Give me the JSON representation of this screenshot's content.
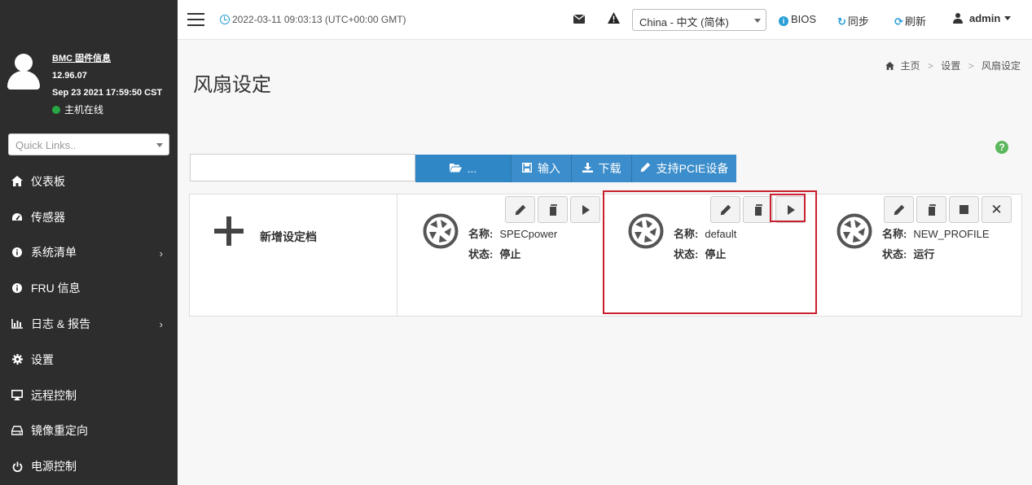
{
  "sidebar": {
    "firmware_link": "BMC 固件信息",
    "version": "12.96.07",
    "build_date": "Sep 23 2021 17:59:50 CST",
    "host_status": "主机在线",
    "quick_links_placeholder": "Quick Links..",
    "items": [
      {
        "label": "仪表板",
        "icon": "home-icon",
        "expandable": false
      },
      {
        "label": "传感器",
        "icon": "gauge-icon",
        "expandable": false
      },
      {
        "label": "系统清单",
        "icon": "info-icon",
        "expandable": true
      },
      {
        "label": "FRU 信息",
        "icon": "info-icon",
        "expandable": false
      },
      {
        "label": "日志 & 报告",
        "icon": "bar-chart-icon",
        "expandable": true
      },
      {
        "label": "设置",
        "icon": "gear-icon",
        "expandable": false
      },
      {
        "label": "远程控制",
        "icon": "monitor-icon",
        "expandable": false
      },
      {
        "label": "镜像重定向",
        "icon": "drive-icon",
        "expandable": false
      },
      {
        "label": "电源控制",
        "icon": "power-icon",
        "expandable": false
      }
    ]
  },
  "topbar": {
    "datetime": "2022-03-11 09:03:13 (UTC+00:00 GMT)",
    "language": "China - 中文 (简体)",
    "bios": "BIOS",
    "sync": "同步",
    "refresh": "刷新",
    "user": "admin"
  },
  "page": {
    "title": "风扇设定",
    "breadcrumb": [
      "主页",
      "设置",
      "风扇设定"
    ]
  },
  "toolbar": {
    "browse": "...",
    "import": "输入",
    "download": "下载",
    "pcie": "支持PCIE设备"
  },
  "profiles": {
    "add_label": "新增设定档",
    "name_label": "名称:",
    "status_label": "状态:",
    "items": [
      {
        "name": "SPECpower",
        "status": "停止"
      },
      {
        "name": "default",
        "status": "停止"
      },
      {
        "name": "NEW_PROFILE",
        "status": "运行"
      }
    ]
  },
  "colors": {
    "sidebar_bg": "#2d2d2d",
    "accent_blue": "#3b8dcb",
    "highlight_red": "#c8202e",
    "online_green": "#27a844"
  }
}
